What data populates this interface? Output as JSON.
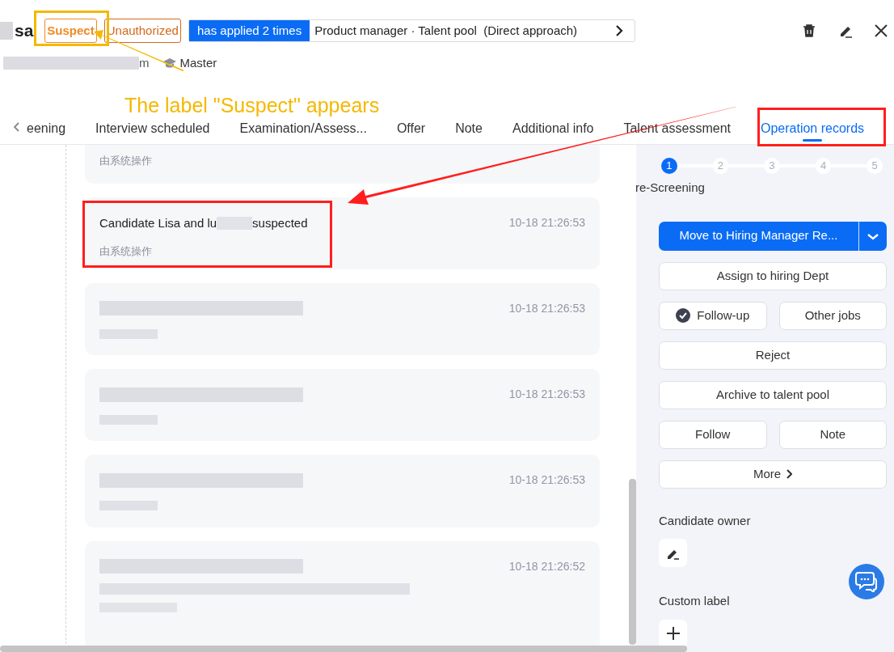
{
  "header": {
    "name": "sa",
    "tags": [
      {
        "text": "Suspect",
        "kind": "suspect"
      },
      {
        "text": "Unauthorized",
        "kind": "outline"
      }
    ],
    "applied": {
      "count": "has applied 2 times",
      "job": "Product manager · Talent pool  (Direct approach)"
    },
    "email_end": "m",
    "education": "Master"
  },
  "tabs": [
    {
      "label": "eening",
      "selected": false
    },
    {
      "label": "Interview scheduled",
      "selected": false
    },
    {
      "label": "Examination/Assess...",
      "selected": false
    },
    {
      "label": "Offer",
      "selected": false
    },
    {
      "label": "Note",
      "selected": false
    },
    {
      "label": "Additional info",
      "selected": false
    },
    {
      "label": "Talent assessment",
      "selected": false
    },
    {
      "label": "Operation records",
      "selected": true
    }
  ],
  "records": [
    {
      "kind": "partial",
      "operator": "由系统操作"
    },
    {
      "kind": "text",
      "title": "Candidate Lisa and lu",
      "title_end": "suspected",
      "time": "10-18 21:26:53",
      "operator": "由系统操作"
    },
    {
      "kind": "redacted",
      "time": "10-18 21:26:53"
    },
    {
      "kind": "redacted",
      "time": "10-18 21:26:53"
    },
    {
      "kind": "redacted",
      "time": "10-18 21:26:53"
    },
    {
      "kind": "redacted_long",
      "time": "10-18 21:26:52"
    }
  ],
  "stage": {
    "steps": [
      {
        "number": "1",
        "selected": true
      },
      {
        "number": "2",
        "selected": false
      },
      {
        "number": "3",
        "selected": false
      },
      {
        "number": "4",
        "selected": false
      },
      {
        "number": "5",
        "selected": false
      }
    ],
    "label": "re-Screening"
  },
  "actions": [
    [
      {
        "label": "Move to Hiring Manager Re...",
        "kind": "primary"
      }
    ],
    [
      {
        "label": "Assign to hiring Dept",
        "kind": "plain"
      }
    ],
    [
      {
        "label": "Follow-up",
        "kind": "checked"
      },
      {
        "label": "Other jobs",
        "kind": "plain"
      }
    ],
    [
      {
        "label": "Reject",
        "kind": "plain"
      }
    ],
    [
      {
        "label": "Archive to talent pool",
        "kind": "plain"
      }
    ],
    [
      {
        "label": "Follow",
        "kind": "plain"
      },
      {
        "label": "Note",
        "kind": "plain"
      }
    ],
    [
      {
        "label": "More",
        "kind": "more"
      }
    ]
  ],
  "owner_label": "Candidate owner",
  "custom_label": "Custom label",
  "annotation": {
    "caption": "The label \"Suspect\" appears"
  }
}
